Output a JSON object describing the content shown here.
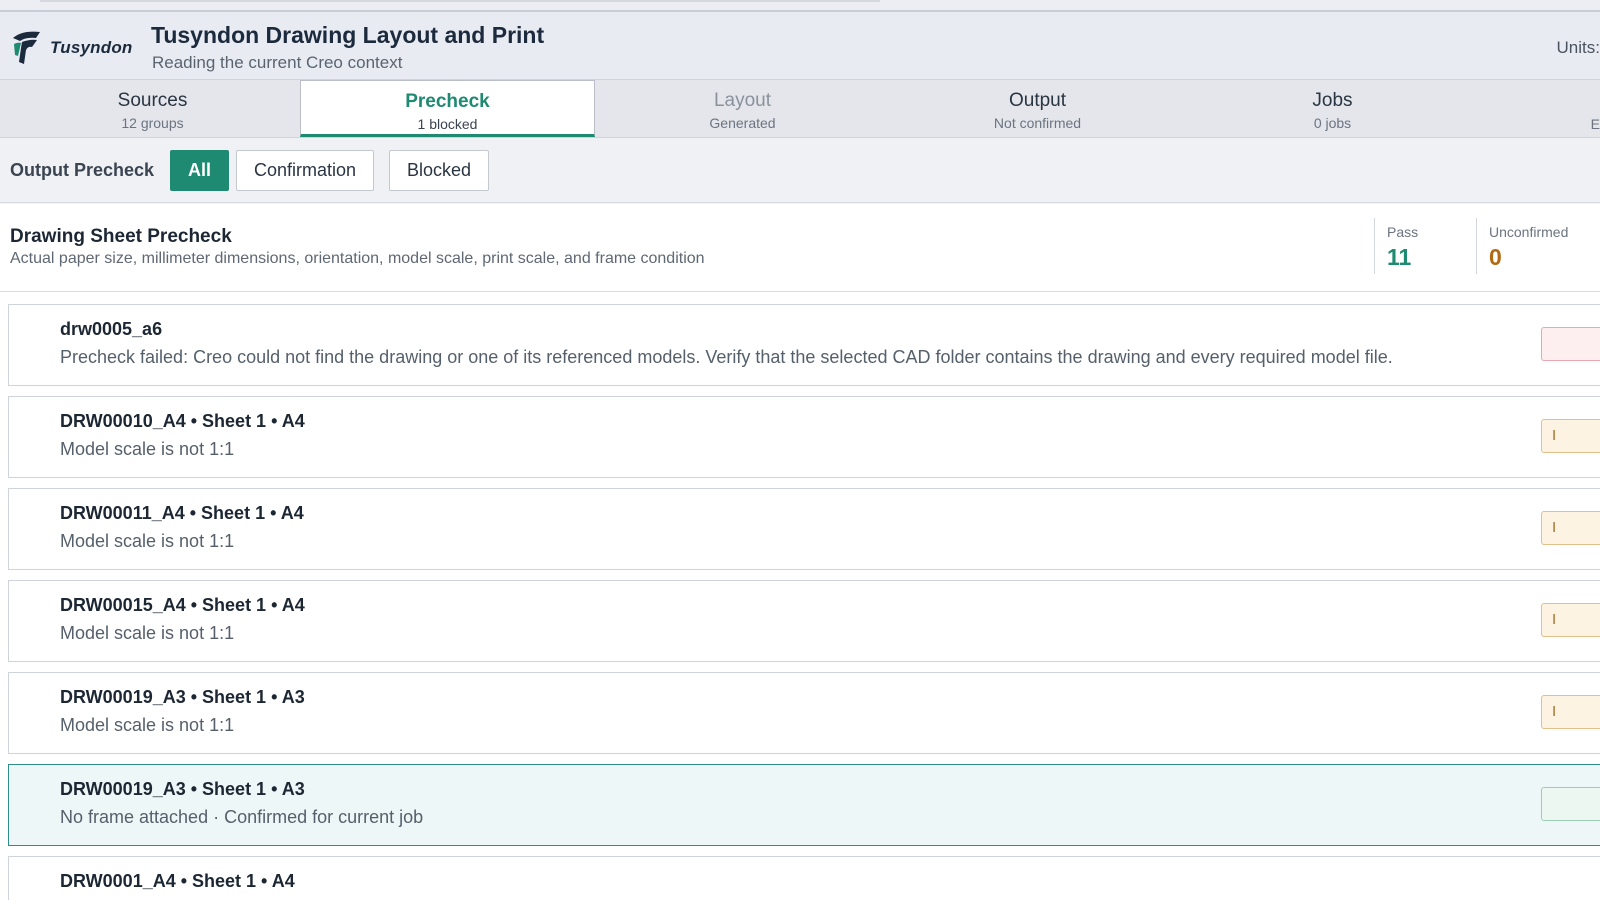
{
  "header": {
    "logo_text": "Tusyndon",
    "title": "Tusyndon Drawing Layout and Print",
    "subtitle": "Reading the current Creo context",
    "units_label": "Units:"
  },
  "steps": [
    {
      "label": "Sources",
      "sub": "12 groups"
    },
    {
      "label": "Precheck",
      "sub": "1 blocked"
    },
    {
      "label": "Layout",
      "sub": "Generated"
    },
    {
      "label": "Output",
      "sub": "Not confirmed"
    },
    {
      "label": "Jobs",
      "sub": "0 jobs"
    }
  ],
  "steps_edge_fragment": "E",
  "filter": {
    "label": "Output Precheck",
    "buttons": [
      "All",
      "Confirmation",
      "Blocked"
    ],
    "active": "All"
  },
  "summary": {
    "title": "Drawing Sheet Precheck",
    "description": "Actual paper size, millimeter dimensions, orientation, model scale, print scale, and frame condition",
    "stats": [
      {
        "label": "Pass",
        "value": "11",
        "color": "#1e8a71"
      },
      {
        "label": "Unconfirmed",
        "value": "0",
        "color": "#b26a12"
      }
    ]
  },
  "rows": [
    {
      "title": "drw0005_a6",
      "desc": "Precheck failed: Creo could not find the drawing or one of its referenced models. Verify that the selected CAD folder contains the drawing and every required model file.",
      "badge": "",
      "status": "fail"
    },
    {
      "title": "DRW00010_A4 • Sheet 1 • A4",
      "desc": "Model scale is not 1:1",
      "badge": "I",
      "status": "warn"
    },
    {
      "title": "DRW00011_A4 • Sheet 1 • A4",
      "desc": "Model scale is not 1:1",
      "badge": "I",
      "status": "warn"
    },
    {
      "title": "DRW00015_A4 • Sheet 1 • A4",
      "desc": "Model scale is not 1:1",
      "badge": "I",
      "status": "warn"
    },
    {
      "title": "DRW00019_A3 • Sheet 1 • A3",
      "desc": "Model scale is not 1:1",
      "badge": "I",
      "status": "warn"
    },
    {
      "title": "DRW00019_A3 • Sheet 1 • A3",
      "desc": "No frame attached · Confirmed for current job",
      "badge": "",
      "status": "ok",
      "selected": true
    },
    {
      "title": "DRW0001_A4 • Sheet 1 • A4",
      "desc": "",
      "badge": "",
      "status": "warn"
    }
  ],
  "colors": {
    "accent": "#1e8a71",
    "warn": "#a0702c",
    "fail": "#b03a4a"
  }
}
